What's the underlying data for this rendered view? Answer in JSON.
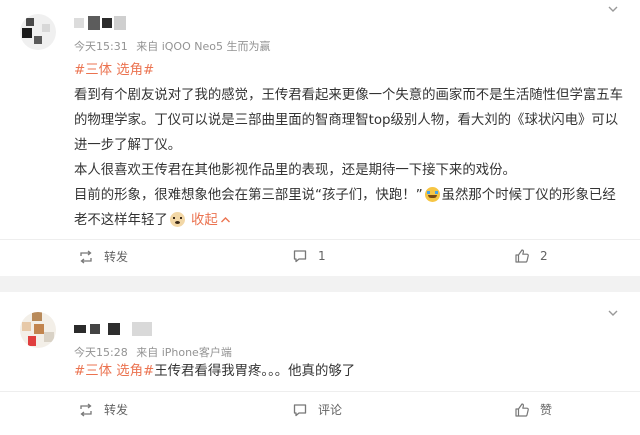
{
  "posts": [
    {
      "meta": {
        "time": "今天15:31",
        "source": "来自 iQOO Neo5 生而为赢"
      },
      "tag": "#三体 选角#",
      "paragraphs": [
        "看到有个剧友说对了我的感觉，王传君看起来更像一个失意的画家而不是生活随性但学富五车的物理学家。丁仪可以说是三部曲里面的智商理智top级别人物，看大刘的《球状闪电》可以进一步了解丁仪。",
        "本人很喜欢王传君在其他影视作品里的表现，还是期待一下接下来的戏份。"
      ],
      "p3_main": "目前的形象，很难想象他会在第三部里说“孩子们，快跑！”",
      "p3_tail": "虽然那个时候丁仪的形象已经老不这样年轻了",
      "collapse_label": "收起",
      "actions": {
        "repost": "转发",
        "comment": "1",
        "like": "2"
      }
    },
    {
      "meta": {
        "time": "今天15:28",
        "source": "来自 iPhone客户端"
      },
      "tag": "#三体 选角#",
      "body": "王传君看得我胃疼。。。他真的够了",
      "actions": {
        "repost": "转发",
        "comment": "评论",
        "like": "赞"
      }
    }
  ],
  "colors": {
    "accent": "#eb7350",
    "meta": "#939393",
    "text": "#333333",
    "separator": "#f2f2f2"
  },
  "icons": [
    "more-down-icon",
    "repost-icon",
    "comment-icon",
    "like-icon",
    "cry-emoji",
    "dog-emoji",
    "chevron-up-icon"
  ]
}
